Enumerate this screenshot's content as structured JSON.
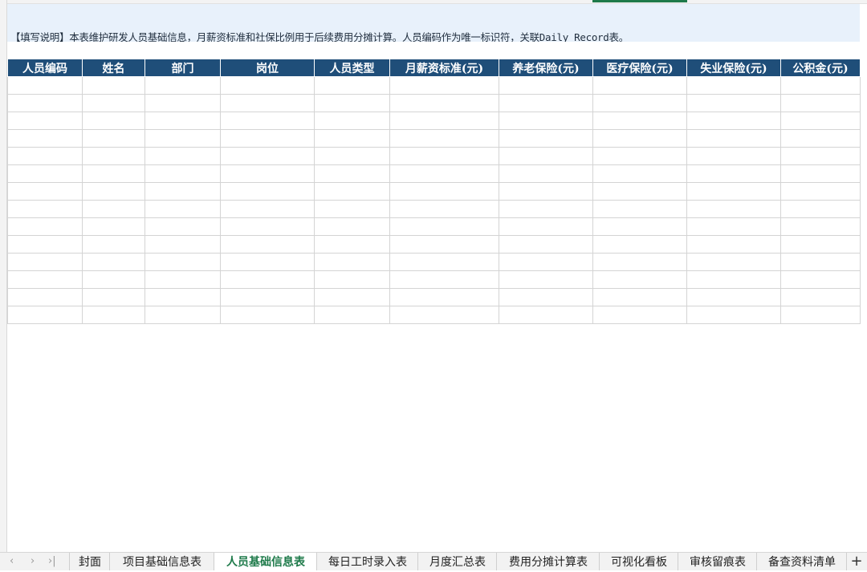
{
  "note": {
    "text": "【填写说明】本表维护研发人员基础信息，月薪资标准和社保比例用于后续费用分摊计算。人员编码作为唯一标识符，关联Daily_Record表。"
  },
  "table": {
    "columns": [
      "人员编码",
      "姓名",
      "部门",
      "岗位",
      "人员类型",
      "月薪资标准(元)",
      "养老保险(元)",
      "医疗保险(元)",
      "失业保险(元)",
      "公积金(元)"
    ],
    "rows": [
      [
        "",
        "",
        "",
        "",
        "",
        "",
        "",
        "",
        "",
        ""
      ],
      [
        "",
        "",
        "",
        "",
        "",
        "",
        "",
        "",
        "",
        ""
      ],
      [
        "",
        "",
        "",
        "",
        "",
        "",
        "",
        "",
        "",
        ""
      ],
      [
        "",
        "",
        "",
        "",
        "",
        "",
        "",
        "",
        "",
        ""
      ],
      [
        "",
        "",
        "",
        "",
        "",
        "",
        "",
        "",
        "",
        ""
      ],
      [
        "",
        "",
        "",
        "",
        "",
        "",
        "",
        "",
        "",
        ""
      ],
      [
        "",
        "",
        "",
        "",
        "",
        "",
        "",
        "",
        "",
        ""
      ],
      [
        "",
        "",
        "",
        "",
        "",
        "",
        "",
        "",
        "",
        ""
      ],
      [
        "",
        "",
        "",
        "",
        "",
        "",
        "",
        "",
        "",
        ""
      ],
      [
        "",
        "",
        "",
        "",
        "",
        "",
        "",
        "",
        "",
        ""
      ],
      [
        "",
        "",
        "",
        "",
        "",
        "",
        "",
        "",
        "",
        ""
      ],
      [
        "",
        "",
        "",
        "",
        "",
        "",
        "",
        "",
        "",
        ""
      ],
      [
        "",
        "",
        "",
        "",
        "",
        "",
        "",
        "",
        "",
        ""
      ],
      [
        "",
        "",
        "",
        "",
        "",
        "",
        "",
        "",
        "",
        ""
      ]
    ]
  },
  "tabbar": {
    "nav": {
      "prev": "‹",
      "next": "›",
      "last": "›|"
    },
    "tabs": [
      {
        "label": "封面",
        "active": false
      },
      {
        "label": "项目基础信息表",
        "active": false
      },
      {
        "label": "人员基础信息表",
        "active": true
      },
      {
        "label": "每日工时录入表",
        "active": false
      },
      {
        "label": "月度汇总表",
        "active": false
      },
      {
        "label": "费用分摊计算表",
        "active": false
      },
      {
        "label": "可视化看板",
        "active": false
      },
      {
        "label": "审核留痕表",
        "active": false
      },
      {
        "label": "备查资料清单",
        "active": false
      }
    ],
    "add": "+"
  },
  "colors": {
    "header_bg": "#1f4e79",
    "note_bg": "#e8f1fb",
    "active_tab": "#1e7a4a"
  }
}
